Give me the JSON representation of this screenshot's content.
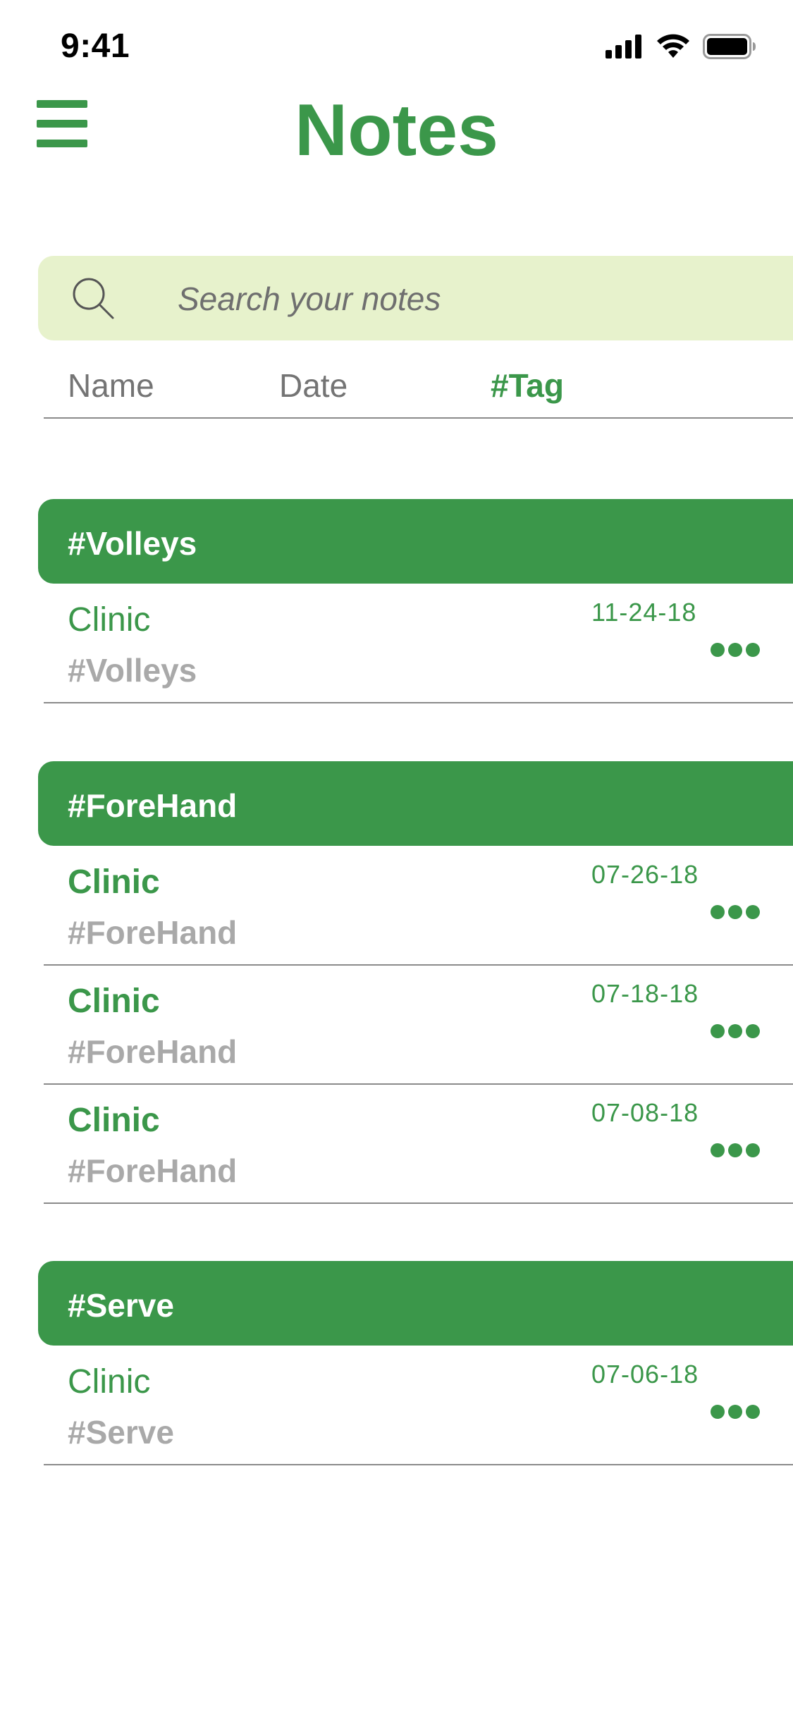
{
  "status": {
    "time": "9:41",
    "icons": [
      "signal-icon",
      "wifi-icon",
      "battery-icon"
    ]
  },
  "header": {
    "title": "Notes",
    "menu_icon": "hamburger-menu-icon"
  },
  "search": {
    "placeholder": "Search your notes",
    "icon": "search-icon"
  },
  "sort_tabs": [
    {
      "label": "Name",
      "active": false
    },
    {
      "label": "Date",
      "active": false
    },
    {
      "label": "#Tag",
      "active": true
    }
  ],
  "groups": [
    {
      "label": "#Volleys",
      "notes": [
        {
          "title": "Clinic",
          "tag": "#Volleys",
          "date": "11-24-18",
          "bold": false
        }
      ]
    },
    {
      "label": "#ForeHand",
      "notes": [
        {
          "title": "Clinic",
          "tag": "#ForeHand",
          "date": "07-26-18",
          "bold": true
        },
        {
          "title": "Clinic",
          "tag": "#ForeHand",
          "date": "07-18-18",
          "bold": true
        },
        {
          "title": "Clinic",
          "tag": "#ForeHand",
          "date": "07-08-18",
          "bold": true
        }
      ]
    },
    {
      "label": "#Serve",
      "notes": [
        {
          "title": "Clinic",
          "tag": "#Serve",
          "date": "07-06-18",
          "bold": false
        }
      ]
    }
  ],
  "colors": {
    "accent": "#3b974a",
    "search_bg": "#e7f2cc",
    "tag_gray": "#a9a9a9",
    "divider": "#8a8a8a"
  }
}
